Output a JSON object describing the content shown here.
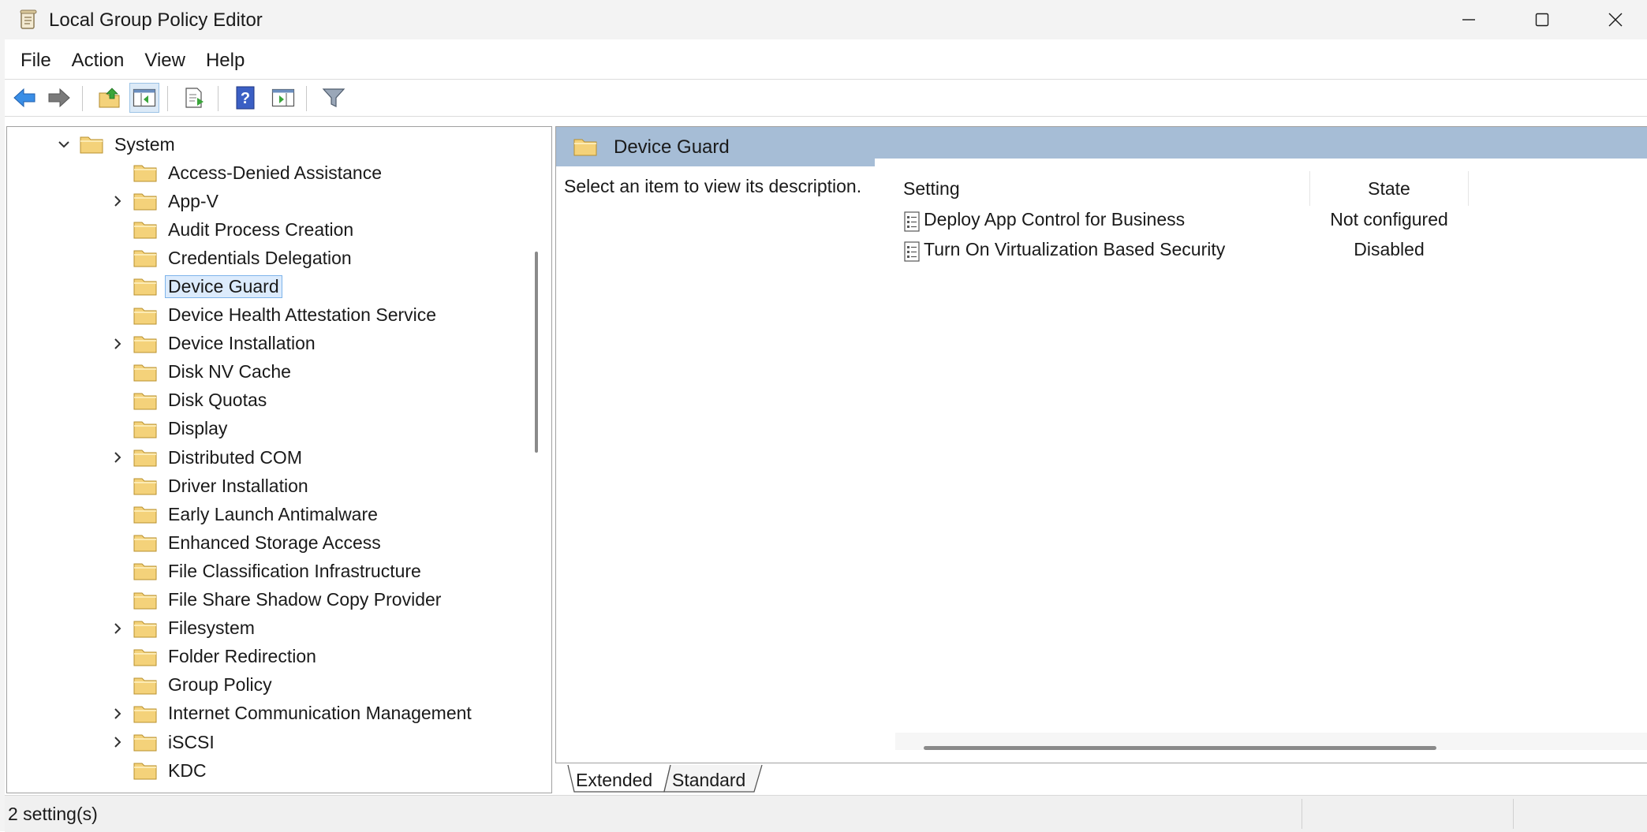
{
  "window": {
    "title": "Local Group Policy Editor",
    "controls": [
      "minimize",
      "maximize",
      "close"
    ]
  },
  "menu": [
    "File",
    "Action",
    "View",
    "Help"
  ],
  "toolbar": {
    "buttons": [
      "back-arrow-icon",
      "forward-arrow-icon",
      "up-folder-icon",
      "show-hide-tree-icon",
      "export-list-icon",
      "help-icon",
      "show-hide-action-pane-icon",
      "filter-icon"
    ]
  },
  "tree": {
    "parent": "System",
    "items": [
      {
        "label": "Access-Denied Assistance",
        "expandable": false
      },
      {
        "label": "App-V",
        "expandable": true
      },
      {
        "label": "Audit Process Creation",
        "expandable": false
      },
      {
        "label": "Credentials Delegation",
        "expandable": false
      },
      {
        "label": "Device Guard",
        "expandable": false,
        "selected": true
      },
      {
        "label": "Device Health Attestation Service",
        "expandable": false
      },
      {
        "label": "Device Installation",
        "expandable": true
      },
      {
        "label": "Disk NV Cache",
        "expandable": false
      },
      {
        "label": "Disk Quotas",
        "expandable": false
      },
      {
        "label": "Display",
        "expandable": false
      },
      {
        "label": "Distributed COM",
        "expandable": true
      },
      {
        "label": "Driver Installation",
        "expandable": false
      },
      {
        "label": "Early Launch Antimalware",
        "expandable": false
      },
      {
        "label": "Enhanced Storage Access",
        "expandable": false
      },
      {
        "label": "File Classification Infrastructure",
        "expandable": false
      },
      {
        "label": "File Share Shadow Copy Provider",
        "expandable": false
      },
      {
        "label": "Filesystem",
        "expandable": true
      },
      {
        "label": "Folder Redirection",
        "expandable": false
      },
      {
        "label": "Group Policy",
        "expandable": false
      },
      {
        "label": "Internet Communication Management",
        "expandable": true
      },
      {
        "label": "iSCSI",
        "expandable": true
      },
      {
        "label": "KDC",
        "expandable": false
      }
    ]
  },
  "details": {
    "header_title": "Device Guard",
    "description": "Select an item to view its description.",
    "columns": {
      "setting": "Setting",
      "state": "State"
    },
    "rows": [
      {
        "setting": "Deploy App Control for Business",
        "state": "Not configured"
      },
      {
        "setting": "Turn On Virtualization Based Security",
        "state": "Disabled"
      }
    ]
  },
  "tabs": {
    "extended": "Extended",
    "standard": "Standard"
  },
  "status": {
    "text": "2 setting(s)"
  },
  "colors": {
    "header_band": "#a6bdd6",
    "selection": "#dcebfc",
    "folder": "#f4d27a"
  }
}
